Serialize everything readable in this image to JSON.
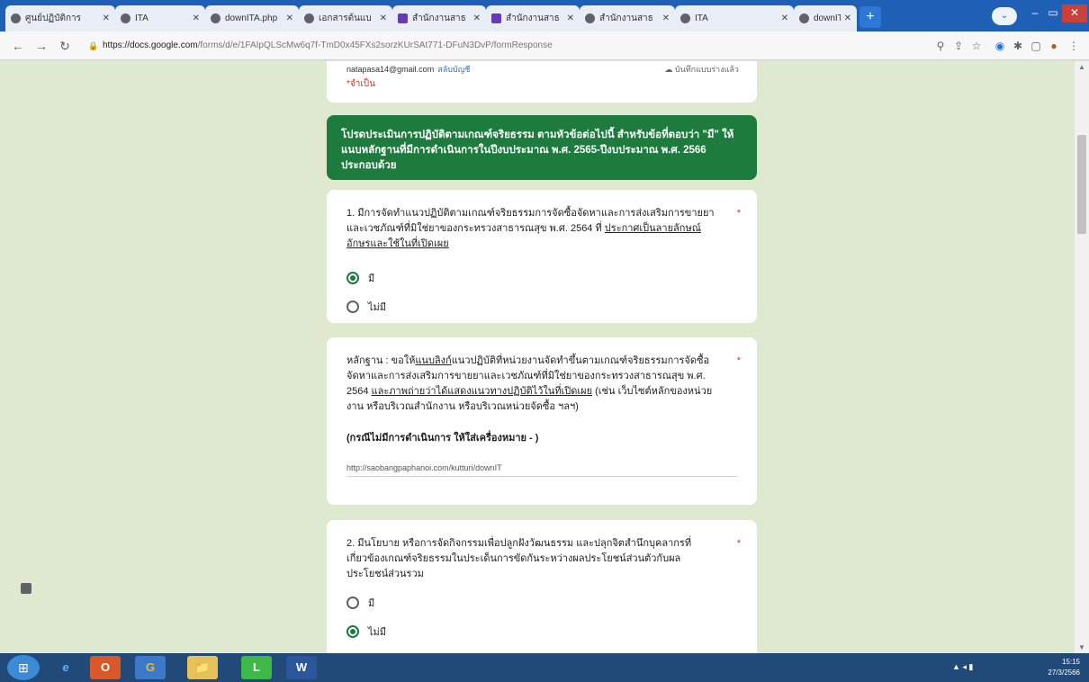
{
  "browser": {
    "tabs": [
      {
        "label": "ศูนย์ปฏิบัติการ",
        "icon": "globe-icon"
      },
      {
        "label": "ITA",
        "icon": "globe-icon"
      },
      {
        "label": "downITA.php",
        "icon": "globe-icon"
      },
      {
        "label": "เอกสารต้นแบ",
        "icon": "globe-icon"
      },
      {
        "label": "สำนักงานสาธ",
        "icon": "google-forms-icon"
      },
      {
        "label": "สำนักงานสาธ",
        "icon": "google-forms-icon"
      },
      {
        "label": "สำนักงานสาธ",
        "icon": "globe-icon"
      },
      {
        "label": "ITA",
        "icon": "globe-icon"
      },
      {
        "label": "downITA.php",
        "icon": "globe-icon"
      }
    ],
    "url_host": "https://docs.google.com",
    "url_path": "/forms/d/e/1FAIpQLScMw6q7f-TmD0x45FXs2sorzKUrSAt771-DFuN3DvP/formResponse"
  },
  "form": {
    "account_email": "natapasa14@gmail.com",
    "switch_account": "สลับบัญชี",
    "save_status": "บันทึกแบบร่างแล้ว",
    "required_note": "*จำเป็น",
    "section_description": "โปรดประเมินการปฏิบัติตามเกณฑ์จริยธรรม ตามหัวข้อต่อไปนี้ สำหรับข้อที่ตอบว่า \"มี\" ให้แนบหลักฐานที่มีการดำเนินการในปีงบประมาณ พ.ศ. 2565-ปีงบประมาณ พ.ศ. 2566 ประกอบด้วย",
    "q1": {
      "title_a": "1. มีการจัดทำแนวปฏิบัติตามเกณฑ์จริยธรรมการจัดซื้อจัดหาและการส่งเสริมการขายยาและเวชภัณฑ์ที่มิใช่ยาของกระทรวงสาธารณสุข พ.ศ. 2564 ที่",
      "title_b": "ประกาศเป็นลายลักษณ์อักษรและใช้ในที่เปิดเผย",
      "required": "*",
      "options": [
        "มี",
        "ไม่มี"
      ],
      "selected": "มี"
    },
    "evidence1": {
      "title_a": "หลักฐาน : ขอให้",
      "title_b": "แนบลิงก์",
      "title_c": "แนวปฏิบัติที่หน่วยงานจัดทำขึ้นตามเกณฑ์จริยธรรมการจัดซื้อจัดหาและการส่งเสริมการขายยาและเวชภัณฑ์ที่มิใช่ยาของกระทรวงสาธารณสุข พ.ศ. 2564",
      "title_d": "และภาพถ่ายว่าได้แสดงแนวทางปฏิบัติไว้ในที่เปิดเผย",
      "title_e": "(เช่น เว็บไซต์หลักของหน่วยงาน หรือบริเวณสำนักงาน หรือบริเวณหน่วยจัดซื้อ ฯลฯ)",
      "required": "*",
      "note": "(กรณีไม่มีการดำเนินการ ให้ใส่เครื่องหมาย - )",
      "answer": "http://saobangpaphanoi.com/kutturi/downIT"
    },
    "q2": {
      "title": "2. มีนโยบาย หรือการจัดกิจกรรมเพื่อปลูกฝังวัฒนธรรม และปลุกจิตสำนึกบุคลากรที่เกี่ยวข้องเกณฑ์จริยธรรมในประเด็นการขัดกันระหว่างผลประโยชน์ส่วนตัวกับผลประโยชน์ส่วนรวม",
      "required": "*",
      "options": [
        "มี",
        "ไม่มี"
      ],
      "selected": "ไม่มี"
    }
  },
  "taskbar": {
    "apps": [
      "e",
      "O",
      "G",
      "📁",
      "L",
      "W"
    ],
    "time": "15:15",
    "date": "27/3/2566"
  },
  "colors": {
    "form_theme": "#1d7c3d",
    "page_bg": "#dfe9cf",
    "taskbar": "#214a78"
  }
}
